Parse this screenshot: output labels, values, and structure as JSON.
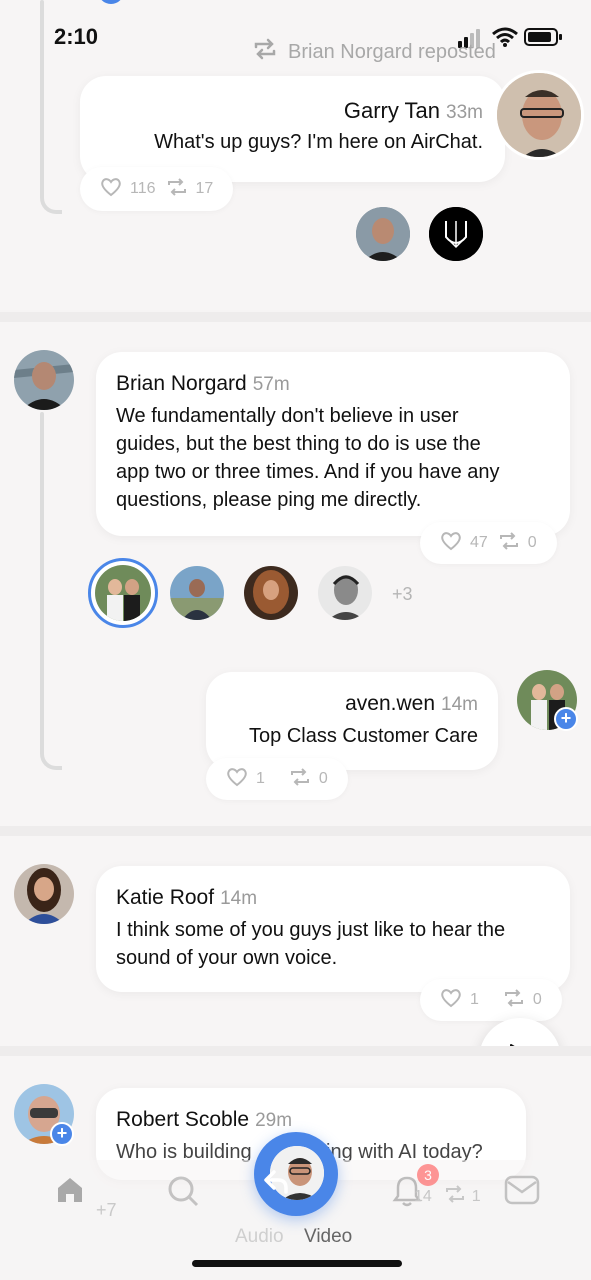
{
  "status_bar": {
    "time": "2:10"
  },
  "repost_banner": {
    "text": "Brian Norgard reposted"
  },
  "posts": [
    {
      "author": "Garry Tan",
      "time": "33m",
      "text": "What's up guys? I'm here on AirChat.",
      "likes": "116",
      "reposts": "17"
    },
    {
      "author": "Brian Norgard",
      "time": "57m",
      "text_lines": [
        "We fundamentally don't believe in user",
        "guides, but the best thing to do is use the",
        "app two or three times. And if you have any",
        "questions, please ping me directly."
      ],
      "likes": "47",
      "reposts": "0",
      "listeners_more": "+3"
    },
    {
      "author": "aven.wen",
      "time": "14m",
      "text": "Top Class Customer Care",
      "likes": "1",
      "reposts": "0"
    },
    {
      "author": "Katie Roof",
      "time": "14m",
      "text_lines": [
        "I think some of you guys just like to hear the",
        "sound of your own voice."
      ],
      "likes": "1",
      "reposts": "0"
    },
    {
      "author": "Robert Scoble",
      "time": "29m",
      "text_left": "Who is building",
      "text_right": "ing with AI today?",
      "likes": "14",
      "reposts": "1"
    }
  ],
  "bottom_bar": {
    "more_count": "+7",
    "notification_count": "3",
    "mode_audio": "Audio",
    "mode_video": "Video"
  },
  "colors": {
    "accent": "#4a86e8",
    "badge": "#ff6b6b"
  }
}
